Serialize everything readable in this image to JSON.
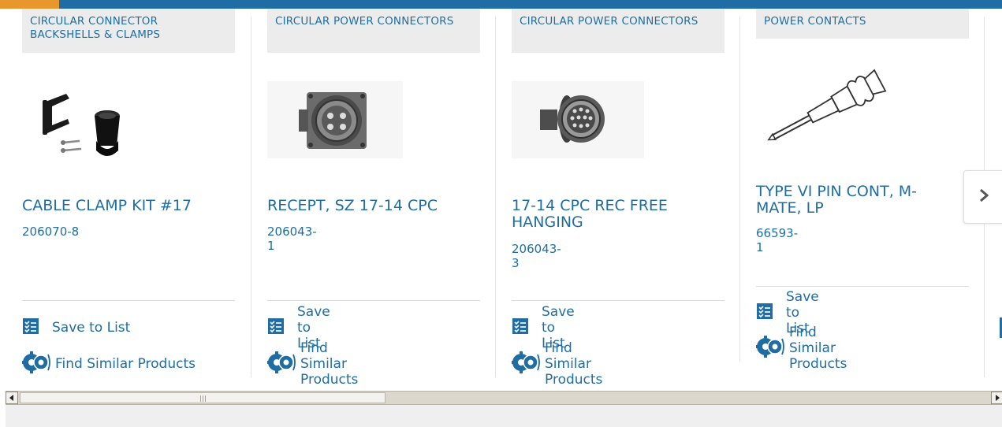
{
  "colors": {
    "link_blue": "#1f6da3",
    "accent_orange": "#e8972c",
    "category_bg": "#ececec"
  },
  "cards": [
    {
      "category": "CIRCULAR CONNECTOR BACKSHELLS & CLAMPS",
      "title": "CABLE CLAMP KIT #17",
      "part_number": "206070-8",
      "save_label": "Save to List",
      "find_label": "Find Similar Products",
      "image_icon": "cable-clamp-kit-image"
    },
    {
      "category": "CIRCULAR POWER CONNECTORS",
      "title": "RECEPT, SZ 17-14 CPC",
      "part_number": "206043-1",
      "save_label": "Save to List",
      "find_label": "Find Similar Products",
      "image_icon": "receptacle-connector-image"
    },
    {
      "category": "CIRCULAR POWER CONNECTORS",
      "title": "17-14 CPC REC FREE HANGING",
      "part_number": "206043-3",
      "save_label": "Save to List",
      "find_label": "Find Similar Products",
      "image_icon": "free-hanging-connector-image"
    },
    {
      "category": "POWER CONTACTS",
      "title": "TYPE VI PIN CONT, M-MATE, LP",
      "part_number": "66593-1",
      "save_label": "Save to List",
      "find_label": "Find Similar Products",
      "image_icon": "pin-contact-image"
    }
  ],
  "carousel": {
    "next_icon": "chevron-right-icon"
  },
  "scrollbar": {
    "left_icon": "scroll-left-arrow-icon",
    "right_icon": "scroll-right-arrow-icon"
  }
}
